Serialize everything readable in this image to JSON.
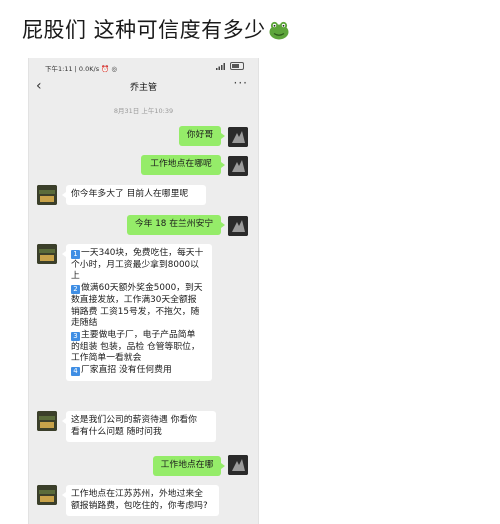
{
  "post": {
    "title": "屁股们 这种可信度有多少"
  },
  "status_bar": {
    "left": "下午1:11 | 0.0K/s ⏰ ◎",
    "right_signal": "ᵢₗ"
  },
  "chat": {
    "title": "乔主管",
    "timestamp": "8月31日 上午10:39",
    "messages": [
      {
        "from": "me",
        "lines": [
          "你好哥"
        ]
      },
      {
        "from": "me",
        "lines": [
          "工作地点在哪呢"
        ]
      },
      {
        "from": "them",
        "lines": [
          "你今年多大了  目前人在哪里呢"
        ]
      },
      {
        "from": "me",
        "lines": [
          "今年 18 在兰州安宁"
        ]
      },
      {
        "from": "them",
        "items": [
          {
            "num": "1",
            "text": "一天340块，免费吃住，每天十"
          },
          {
            "text": "个小时，月工资最少拿到8000以"
          },
          {
            "text": "上"
          },
          {
            "num": "2",
            "text": "做满60天额外奖金5000，到天"
          },
          {
            "text": "数直接发放，工作满30天全额报"
          },
          {
            "text": "销路费  工资15号发，不拖欠，随"
          },
          {
            "text": "走随结"
          },
          {
            "num": "3",
            "text": "主要做电子厂，电子产品简单"
          },
          {
            "text": "的组装 包装，品检 仓管等职位，"
          },
          {
            "text": "工作简单一看就会"
          },
          {
            "num": "4",
            "text": "厂家直招  没有任何费用"
          }
        ]
      },
      {
        "from": "them",
        "lines": [
          "这是我们公司的薪资待遇   你看你",
          "看有什么问题   随时问我"
        ]
      },
      {
        "from": "me",
        "lines": [
          "工作地点在哪"
        ]
      },
      {
        "from": "them",
        "lines": [
          "工作地点在江苏苏州，外地过来全",
          "额报销路费，包吃住的，你考虑吗?"
        ]
      }
    ]
  },
  "colors": {
    "me_bubble": "#95ec69",
    "them_bubble": "#ffffff",
    "chat_bg": "#ededed",
    "number_badge": "#3f8ee4"
  }
}
